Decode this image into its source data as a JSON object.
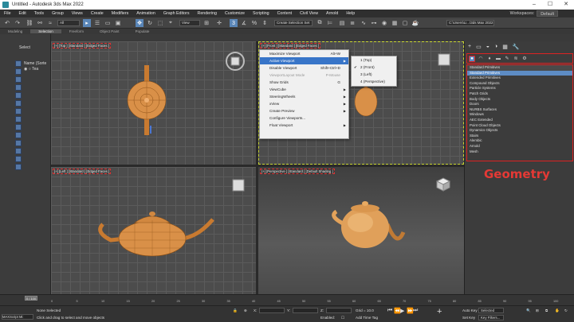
{
  "window": {
    "title": "Untitled - Autodesk 3ds Max 2022",
    "controls": [
      "–",
      "☐",
      "✕"
    ]
  },
  "menu": [
    "File",
    "Edit",
    "Tools",
    "Group",
    "Views",
    "Create",
    "Modifiers",
    "Animation",
    "Graph Editors",
    "Rendering",
    "Customize",
    "Scripting",
    "Content",
    "Civil View",
    "Arnold",
    "Help"
  ],
  "workspace": {
    "label": "Workspaces:",
    "value": "Default"
  },
  "toolbar": {
    "filter": "All",
    "view": "View",
    "selection_set": "Create Selection Set",
    "path": "C:\\Users\\Li...\\3ds Max 2022"
  },
  "ribbon": [
    "Modeling",
    "Selection",
    "Freeform",
    "Object Paint",
    "Populate"
  ],
  "scene": {
    "select": "Select",
    "col_header": "Name (Sorte",
    "item": "Tea"
  },
  "viewports": {
    "top": "[+] [Top ] [Standard ] [Edged Faces ]",
    "front": "[+] [Front ] [Standard ] [Edged Faces ]",
    "left": "[+] [Left ] [Standard ] [Edged Faces ]",
    "persp": "[+] [Perspective ] [Standard ] [Default Shading ]"
  },
  "context_menu": [
    {
      "label": "Maximize Viewport",
      "shortcut": "Alt+W",
      "arrow": "",
      "state": ""
    },
    {
      "label": "Active Viewport",
      "shortcut": "",
      "arrow": "▶",
      "state": "hl"
    },
    {
      "label": "Disable Viewport",
      "shortcut": "Shift+Ctrl+D",
      "arrow": "",
      "state": ""
    },
    {
      "label": "ViewportLayout Mode",
      "shortcut": "P-Mouse",
      "arrow": "",
      "state": "dis"
    },
    {
      "label": "Show Grids",
      "shortcut": "G",
      "arrow": "",
      "state": ""
    },
    {
      "label": "ViewCube",
      "shortcut": "",
      "arrow": "▶",
      "state": ""
    },
    {
      "label": "SteeringWheels",
      "shortcut": "",
      "arrow": "▶",
      "state": ""
    },
    {
      "label": "xView",
      "shortcut": "",
      "arrow": "▶",
      "state": ""
    },
    {
      "label": "Create Preview",
      "shortcut": "",
      "arrow": "▶",
      "state": ""
    },
    {
      "label": "Configure Viewports...",
      "shortcut": "",
      "arrow": "",
      "state": ""
    },
    {
      "label": "Float Viewport",
      "shortcut": "",
      "arrow": "▶",
      "state": ""
    }
  ],
  "submenu": [
    {
      "label": "1 (Top)",
      "checked": ""
    },
    {
      "label": "2 (Front)",
      "checked": "✔"
    },
    {
      "label": "3 (Left)",
      "checked": ""
    },
    {
      "label": "4 (Perspective)",
      "checked": ""
    }
  ],
  "command_panel": {
    "tabs": [
      "+",
      "▭",
      "◒",
      "◑",
      "▦",
      "🔧"
    ],
    "object_types": [
      "Standard Primitives",
      "Standard Primitives",
      "Extended Primitives",
      "Compound Objects",
      "Particle Systems",
      "Patch Grids",
      "Body Objects",
      "Doors",
      "NURBS Surfaces",
      "Windows",
      "AEC Extended",
      "Point Cloud Objects",
      "Dynamics Objects",
      "Stairs",
      "Alembic",
      "Arnold",
      "Mesh"
    ],
    "selected_index": 1,
    "annotation": "Geometry"
  },
  "timeline": {
    "frame": "0 / 100",
    "ticks": [
      "0",
      "5",
      "10",
      "15",
      "20",
      "25",
      "30",
      "35",
      "40",
      "45",
      "50",
      "55",
      "60",
      "65",
      "70",
      "75",
      "80",
      "85",
      "90",
      "95",
      "100"
    ]
  },
  "status": {
    "maxscript": "MAXScript Mi:",
    "none_selected": "None Selected",
    "prompt": "Click and drag to select and move objects",
    "x_label": "X:",
    "y_label": "Y:",
    "z_label": "Z:",
    "grid": "Grid = 10.0",
    "enabled": "Enabled:",
    "add_time_tag": "Add Time Tag",
    "auto_key": "Auto Key",
    "selected": "Selected",
    "set_key": "Set Key",
    "key_filters": "Key Filters..."
  }
}
